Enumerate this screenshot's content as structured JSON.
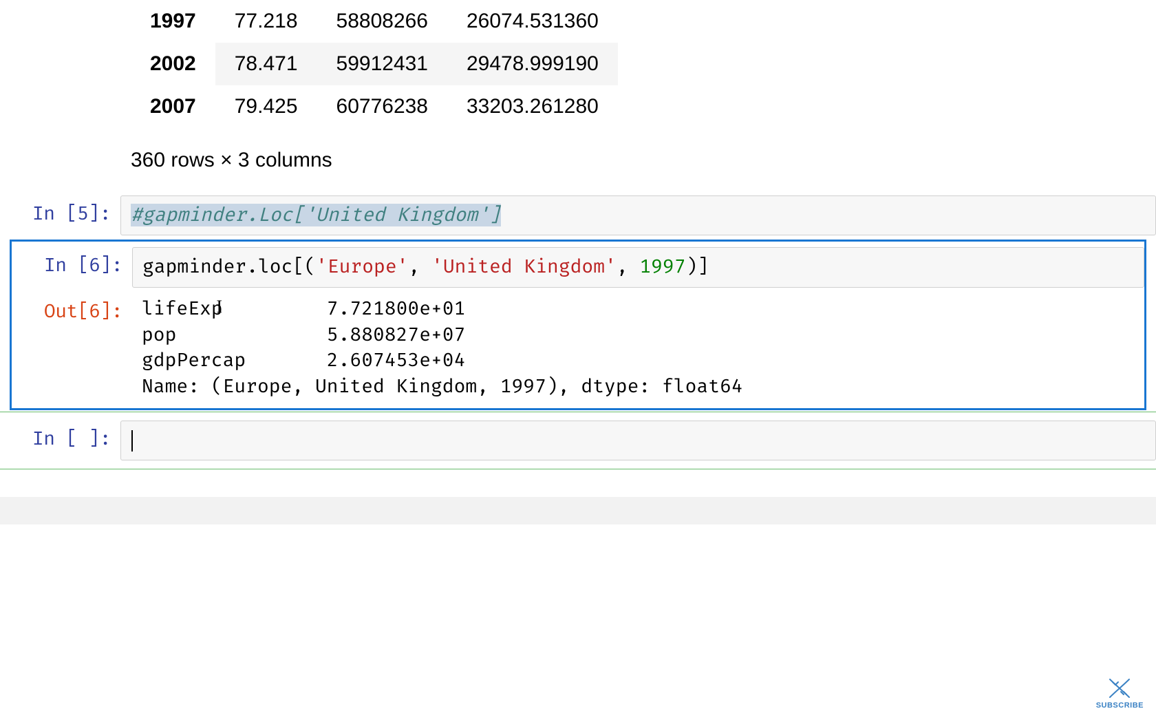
{
  "table": {
    "rows": [
      {
        "year": "1997",
        "lifeExp": "77.218",
        "pop": "58808266",
        "gdpPercap": "26074.531360"
      },
      {
        "year": "2002",
        "lifeExp": "78.471",
        "pop": "59912431",
        "gdpPercap": "29478.999190"
      },
      {
        "year": "2007",
        "lifeExp": "79.425",
        "pop": "60776238",
        "gdpPercap": "33203.261280"
      }
    ],
    "summary": "360 rows × 3 columns"
  },
  "cells": {
    "in5": {
      "prompt": "In [5]:",
      "code_comment": "#gapminder.Loc['United Kingdom']"
    },
    "in6": {
      "prompt": "In [6]:",
      "code_prefix": "gapminder.loc[(",
      "code_str1": "'Europe'",
      "code_sep1": ", ",
      "code_str2": "'United Kingdom'",
      "code_sep2": ", ",
      "code_num": "1997",
      "code_suffix": ")]"
    },
    "out6": {
      "prompt": "Out[6]:",
      "line1": "lifeExp         7.721800e+01",
      "line2": "pop             5.880827e+07",
      "line3": "gdpPercap       2.607453e+04",
      "line4": "Name: (Europe, United Kingdom, 1997), dtype: float64"
    },
    "inEmpty": {
      "prompt": "In [ ]:"
    }
  },
  "subscribe": {
    "label": "SUBSCRIBE"
  }
}
